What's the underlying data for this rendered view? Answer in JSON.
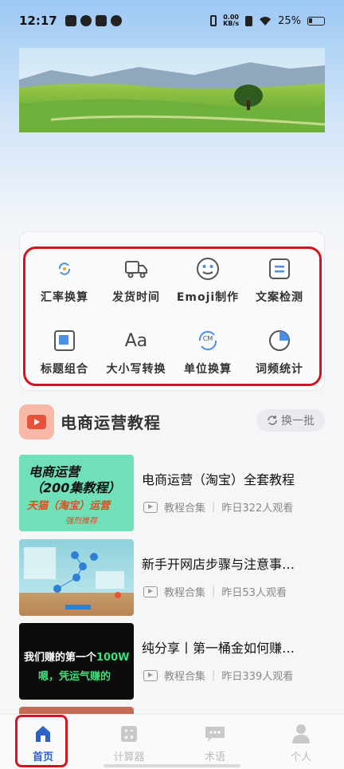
{
  "status_bar": {
    "time": "12:17",
    "net_speed_value": "0.00",
    "net_speed_unit": "KB/s",
    "battery": "25%"
  },
  "tools": [
    {
      "label": "汇率换算",
      "icon": "currency-exchange-icon"
    },
    {
      "label": "发货时间",
      "icon": "delivery-truck-icon"
    },
    {
      "label": "Emoji制作",
      "icon": "smiley-face-icon"
    },
    {
      "label": "文案检测",
      "icon": "document-check-icon"
    },
    {
      "label": "标题组合",
      "icon": "stacked-squares-icon"
    },
    {
      "label": "大小写转换",
      "icon": "case-convert-icon",
      "glyph": "Aa"
    },
    {
      "label": "单位换算",
      "icon": "unit-convert-icon",
      "glyph": "CM"
    },
    {
      "label": "词频统计",
      "icon": "pie-chart-icon"
    }
  ],
  "section": {
    "title": "电商运营教程",
    "refresh_label": "换一批"
  },
  "courses": [
    {
      "title": "电商运营（淘宝）全套教程",
      "category": "教程合集",
      "views": "昨日322人观看",
      "thumb_line1": "电商运营",
      "thumb_line2": "（200集教程）",
      "thumb_line3": "天猫（淘宝）运营",
      "thumb_line4": "强烈推荐"
    },
    {
      "title": "新手开网店步骤与注意事…",
      "category": "教程合集",
      "views": "昨日53人观看"
    },
    {
      "title": "纯分享丨第一桶金如何赚…",
      "category": "教程合集",
      "views": "昨日339人观看",
      "thumb_line1a": "我们赚的第一个",
      "thumb_line1b": "100W",
      "thumb_line2": "嗯，凭运气赚的"
    }
  ],
  "nav": [
    {
      "label": "首页",
      "icon": "home-icon",
      "active": true
    },
    {
      "label": "计算器",
      "icon": "calculator-icon",
      "active": false
    },
    {
      "label": "术语",
      "icon": "chat-bubble-icon",
      "active": false
    },
    {
      "label": "个人",
      "icon": "person-icon",
      "active": false
    }
  ],
  "colors": {
    "accent": "#2f62c9",
    "highlight_red": "#d4141c",
    "section_icon_bg": "#f7b8a8"
  }
}
